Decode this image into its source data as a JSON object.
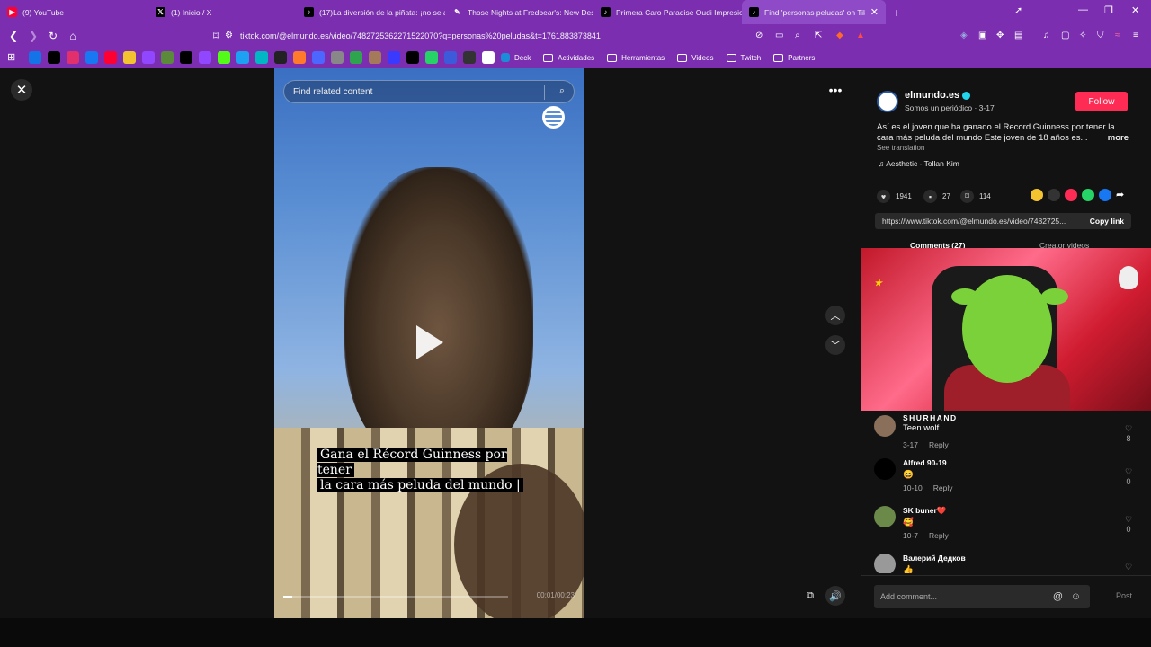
{
  "browser": {
    "tabs": [
      {
        "title": "(9) YouTube",
        "icon": "youtube-icon",
        "color": "#ff0033",
        "active": false
      },
      {
        "title": "(1) Inicio / X",
        "icon": "x-icon",
        "color": "#000000",
        "active": false
      },
      {
        "title": "(17)La diversión de la piñata: ¡no se a",
        "icon": "tiktok-icon",
        "color": "#000000",
        "active": false
      },
      {
        "title": "Those Nights at Fredbear's: New Des",
        "icon": "feather-icon",
        "color": "#ffffff",
        "active": false
      },
      {
        "title": "Primera Caro Paradise Oudi Impresio",
        "icon": "tiktok-icon",
        "color": "#000000",
        "active": false
      },
      {
        "title": "Find 'personas peludas' on TikTo",
        "icon": "tiktok-icon",
        "color": "#000000",
        "active": true
      }
    ],
    "new_tab": "+",
    "url": "tiktok.com/@elmundo.es/video/7482725362271522070?q=personas%20peludas&t=1761883873841",
    "bookmark_folders": [
      "Deck",
      "Actividades",
      "Herramientas",
      "Videos",
      "Twitch",
      "Partners"
    ],
    "accent": "#7b2fb0"
  },
  "video": {
    "search_placeholder": "Find related content",
    "caption_line1": "Gana el Récord Guinness por tener",
    "caption_line2": "la cara más peluda del mundo |",
    "time": "00:01/00:23",
    "progress": 0.04
  },
  "post": {
    "username": "elmundo.es",
    "subtitle": "Somos un periódico · 3-17",
    "follow": "Follow",
    "description": "Así es el joven que ha ganado el Record Guinness por tener la cara más peluda del mundo Este joven de 18 años es...",
    "more": "more",
    "see_translation": "See translation",
    "music": "♫  Aesthetic - Tollan Kim",
    "likes": "1941",
    "comments_count": "27",
    "saves": "114",
    "link": "https://www.tiktok.com/@elmundo.es/video/7482725...",
    "copy_link": "Copy link",
    "tab_comments": "Comments (27)",
    "tab_creator": "Creator videos",
    "follow_color": "#fe2c55"
  },
  "comments": [
    {
      "name": "SHURHAND",
      "text": "Teen wolf",
      "date": "3-17",
      "reply": "Reply",
      "likes": "8"
    },
    {
      "name": "Alfred 90-19",
      "text": "😄",
      "date": "10-10",
      "reply": "Reply",
      "likes": "0"
    },
    {
      "name": "SK buner❤️",
      "text": "🥰",
      "date": "10-7",
      "reply": "Reply",
      "likes": "0"
    },
    {
      "name": "Валерий Дедков",
      "text": "👍",
      "date": "",
      "reply": "",
      "likes": ""
    }
  ],
  "composer": {
    "placeholder": "Add comment...",
    "post": "Post"
  }
}
